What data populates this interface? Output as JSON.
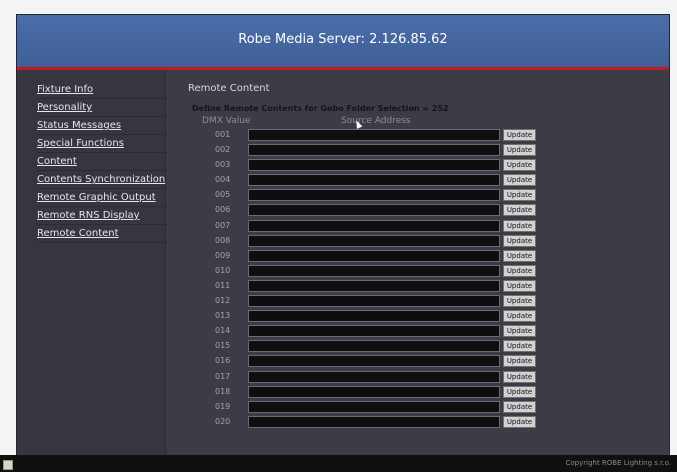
{
  "header": {
    "title": "Robe Media Server: 2.126.85.62"
  },
  "sidebar": {
    "items": [
      {
        "label": "Fixture Info"
      },
      {
        "label": "Personality"
      },
      {
        "label": "Status Messages"
      },
      {
        "label": "Special Functions"
      },
      {
        "label": "Content"
      },
      {
        "label": "Contents Synchronization"
      },
      {
        "label": "Remote Graphic Output"
      },
      {
        "label": "Remote RNS Display"
      },
      {
        "label": "Remote Content"
      }
    ]
  },
  "main": {
    "section_title": "Remote Content",
    "define_text": "Define Remote Contents for Gobo Folder Selection = 252",
    "col_dmx": "DMX Value",
    "col_source": "Source Address",
    "update_label": "Update",
    "rows": [
      {
        "dmx": "001",
        "source": ""
      },
      {
        "dmx": "002",
        "source": ""
      },
      {
        "dmx": "003",
        "source": ""
      },
      {
        "dmx": "004",
        "source": ""
      },
      {
        "dmx": "005",
        "source": ""
      },
      {
        "dmx": "006",
        "source": ""
      },
      {
        "dmx": "007",
        "source": ""
      },
      {
        "dmx": "008",
        "source": ""
      },
      {
        "dmx": "009",
        "source": ""
      },
      {
        "dmx": "010",
        "source": ""
      },
      {
        "dmx": "011",
        "source": ""
      },
      {
        "dmx": "012",
        "source": ""
      },
      {
        "dmx": "013",
        "source": ""
      },
      {
        "dmx": "014",
        "source": ""
      },
      {
        "dmx": "015",
        "source": ""
      },
      {
        "dmx": "016",
        "source": ""
      },
      {
        "dmx": "017",
        "source": ""
      },
      {
        "dmx": "018",
        "source": ""
      },
      {
        "dmx": "019",
        "source": ""
      },
      {
        "dmx": "020",
        "source": ""
      }
    ]
  },
  "footer": {
    "copyright": "Copyright ROBE Lighting s.r.o."
  },
  "colors": {
    "header_bg": "#4b6da7",
    "accent_line": "#c01c1c",
    "panel_bg": "#3c3b46"
  }
}
